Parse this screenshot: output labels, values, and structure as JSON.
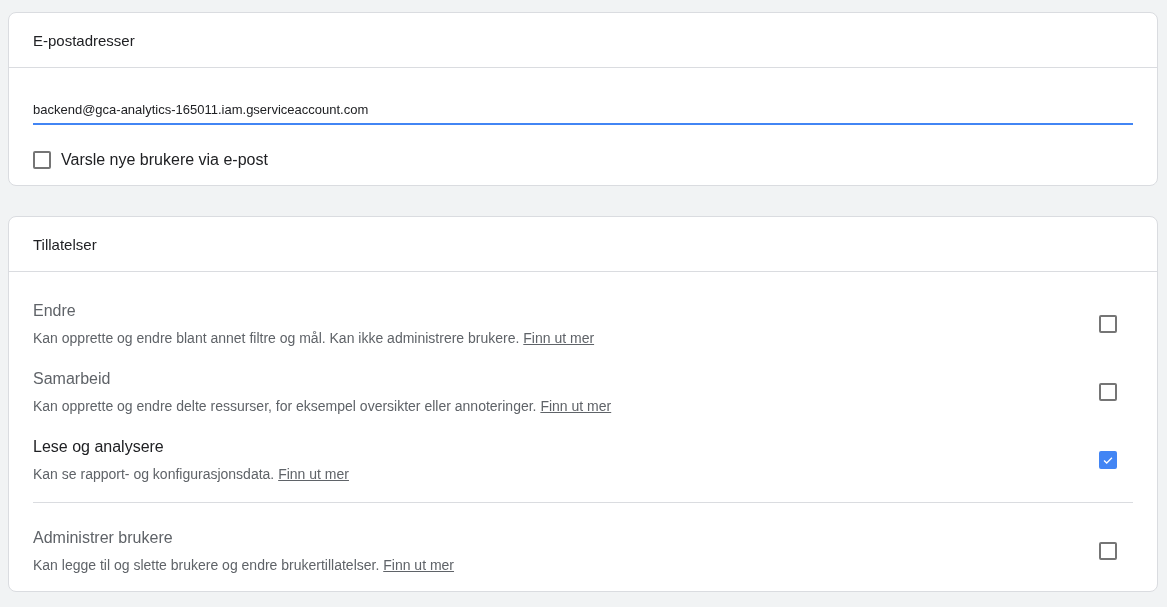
{
  "email_card": {
    "title": "E-postadresser",
    "email": {
      "value": "backend@gca-analytics-165011.iam.gserviceaccount.com"
    },
    "notify": {
      "label": "Varsle nye brukere via e-post",
      "checked": false
    }
  },
  "permissions_card": {
    "title": "Tillatelser",
    "groups": [
      {
        "items": [
          {
            "title": "Endre",
            "description": "Kan opprette og endre blant annet filtre og mål. Kan ikke administrere brukere.",
            "link": "Finn ut mer",
            "checked": false
          },
          {
            "title": "Samarbeid",
            "description": "Kan opprette og endre delte ressurser, for eksempel oversikter eller annoteringer.",
            "link": "Finn ut mer",
            "checked": false
          },
          {
            "title": "Lese og analysere",
            "description": "Kan se rapport- og konfigurasjonsdata.",
            "link": "Finn ut mer",
            "checked": true
          }
        ]
      },
      {
        "items": [
          {
            "title": "Administrer brukere",
            "description": "Kan legge til og slette brukere og endre brukertillatelser.",
            "link": "Finn ut mer",
            "checked": false
          }
        ]
      }
    ]
  }
}
